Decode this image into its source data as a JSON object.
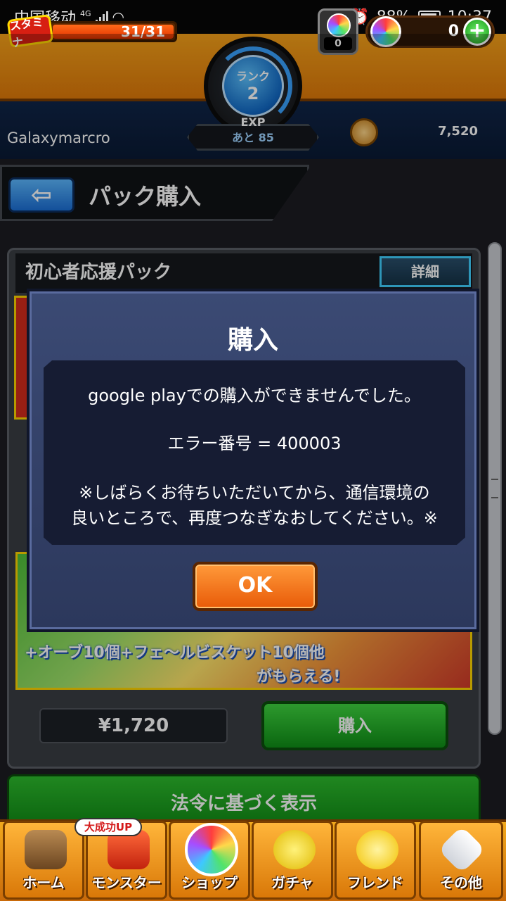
{
  "status_bar": {
    "carrier": "中国移动",
    "network": "4G",
    "battery": "88%",
    "time": "10:37"
  },
  "header": {
    "stamina_label": "スタミナ",
    "stamina_value": "31/31",
    "stamina_fill": 1.0,
    "rank_label": "ランク",
    "rank_value": "2",
    "exp_label": "EXP",
    "exp_remaining": "あと 85",
    "orb_slot_count": "0",
    "orb_count": "0",
    "add_label": "+",
    "player_name": "Galaxymarcro",
    "coins": "7,520"
  },
  "page": {
    "back_label": "⇦",
    "title": "パック購入"
  },
  "pack": {
    "title": "初心者応援パック",
    "detail_label": "詳細",
    "banner_line1": "+オーブ10個+フェ〜ルビスケット10個他",
    "banner_line2": "がもらえる!",
    "price": "¥1,720",
    "buy_label": "購入"
  },
  "legal_label": "法令に基づく表示",
  "dialog": {
    "title": "購入",
    "message": "google playでの購入ができませんでした。",
    "error_line": "エラー番号 =  400003",
    "note_line1": "※しばらくお待ちいただいてから、通信環境の",
    "note_line2": "良いところで、再度つなぎなおしてください。※",
    "ok_label": "OK"
  },
  "bottom_nav": {
    "up_badge": "大成功UP",
    "items": [
      {
        "label": "ホーム",
        "icon": "home-icon"
      },
      {
        "label": "モンスター",
        "icon": "monster-icon"
      },
      {
        "label": "ショップ",
        "icon": "shop-orb-icon"
      },
      {
        "label": "ガチャ",
        "icon": "gacha-egg-icon"
      },
      {
        "label": "フレンド",
        "icon": "friend-icon"
      },
      {
        "label": "その他",
        "icon": "other-icon"
      }
    ]
  }
}
